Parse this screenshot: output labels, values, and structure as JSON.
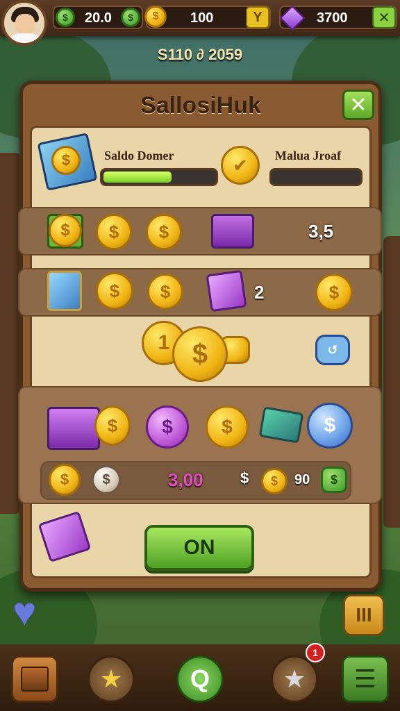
{
  "topbar": {
    "coins_value": "20.0",
    "gold_value": "100",
    "gems_value": "3700"
  },
  "header": {
    "subtitle": "S110 ∂ 2059"
  },
  "panel": {
    "title": "SallosiHuk",
    "left_label": "Saldo Domer",
    "right_label": "Malua Jroaf",
    "left_progress": 0.6,
    "right_progress": 0.0,
    "row1_value": "3,5",
    "row2_value": "2",
    "bottom_value": "3,00",
    "dollar_sign": "$",
    "small_value": "90",
    "on_button": "ON"
  },
  "icons": {
    "close": "close-icon",
    "heart": "heart-icon",
    "bottom_nav": [
      "box-icon",
      "star-icon",
      "search-icon",
      "star-icon",
      "menu-icon"
    ]
  },
  "colors": {
    "accent_green": "#8ad040",
    "gold": "#f0b514",
    "purple": "#c05ad8",
    "panel_brown": "#8a5a30"
  },
  "badges": {
    "star_right": "1"
  }
}
